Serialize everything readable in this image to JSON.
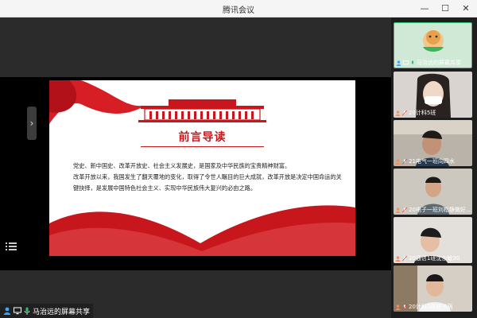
{
  "window": {
    "title": "腾讯会议"
  },
  "slide": {
    "heading": "前言导读",
    "paragraphs": [
      "党史、新中国史、改革开放史、社会主义发展史，是国家及中华民族的宝贵精神财富。",
      "改革开放以来，我国发生了翻天覆地的变化，取得了令世人瞩目的巨大成就，改革开放是决定中国命运的关键抉择，是发展中国特色社会主义、实现中华民族伟大复兴的必由之路。"
    ]
  },
  "presenter": {
    "label": "马治远的屏幕共享"
  },
  "participants": [
    {
      "name": "马治远的屏幕共享",
      "active": true
    },
    {
      "name": "20计科5班"
    },
    {
      "name": "21电气一班向四水"
    },
    {
      "name": "20电子一班刘松静做好..."
    },
    {
      "name": "20通信1班沈沙敏30"
    },
    {
      "name": "20计科2班张书萌"
    }
  ],
  "colors": {
    "accent": "#c8161d",
    "active_border": "#27c36b"
  }
}
